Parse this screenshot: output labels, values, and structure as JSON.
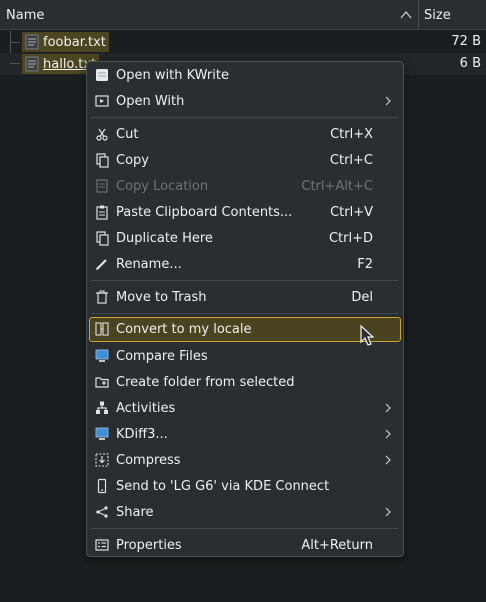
{
  "header": {
    "name_label": "Name",
    "size_label": "Size"
  },
  "files": [
    {
      "name": "foobar.txt",
      "size": "72 B",
      "icon": "text-file-icon"
    },
    {
      "name": "hallo.txt",
      "size": "6 B",
      "icon": "text-file-icon"
    }
  ],
  "menu": {
    "items": [
      {
        "label": "Open with KWrite",
        "icon": "kwrite-icon"
      },
      {
        "label": "Open With",
        "icon": "open-with-icon",
        "submenu": true
      },
      {
        "label": "Cut",
        "shortcut": "Ctrl+X",
        "icon": "scissors-icon"
      },
      {
        "label": "Copy",
        "shortcut": "Ctrl+C",
        "icon": "copy-icon"
      },
      {
        "label": "Copy Location",
        "shortcut": "Ctrl+Alt+C",
        "icon": "copy-location-icon",
        "disabled": true
      },
      {
        "label": "Paste Clipboard Contents...",
        "shortcut": "Ctrl+V",
        "icon": "clipboard-icon"
      },
      {
        "label": "Duplicate Here",
        "shortcut": "Ctrl+D",
        "icon": "duplicate-icon"
      },
      {
        "label": "Rename...",
        "shortcut": "F2",
        "icon": "pencil-icon"
      },
      {
        "label": "Move to Trash",
        "shortcut": "Del",
        "icon": "trash-icon"
      },
      {
        "label": "Convert to my locale",
        "icon": "convert-icon",
        "highlighted": true
      },
      {
        "label": "Compare Files",
        "icon": "monitor-icon"
      },
      {
        "label": "Create folder from selected",
        "icon": "new-folder-icon"
      },
      {
        "label": "Activities",
        "icon": "activities-icon",
        "submenu": true
      },
      {
        "label": "KDiff3...",
        "icon": "kdiff3-icon",
        "submenu": true
      },
      {
        "label": "Compress",
        "icon": "compress-icon",
        "submenu": true
      },
      {
        "label": "Send to 'LG G6' via KDE Connect",
        "icon": "phone-icon"
      },
      {
        "label": "Share",
        "icon": "share-icon",
        "submenu": true
      },
      {
        "label": "Properties",
        "shortcut": "Alt+Return",
        "icon": "properties-icon"
      }
    ]
  },
  "colors": {
    "background": "#1b1e20",
    "menu_background": "#2a2e32",
    "selection_fill": "#4b4520",
    "highlight_border": "#c9a633",
    "text": "#eff0f1",
    "disabled_text": "#6e7377"
  }
}
